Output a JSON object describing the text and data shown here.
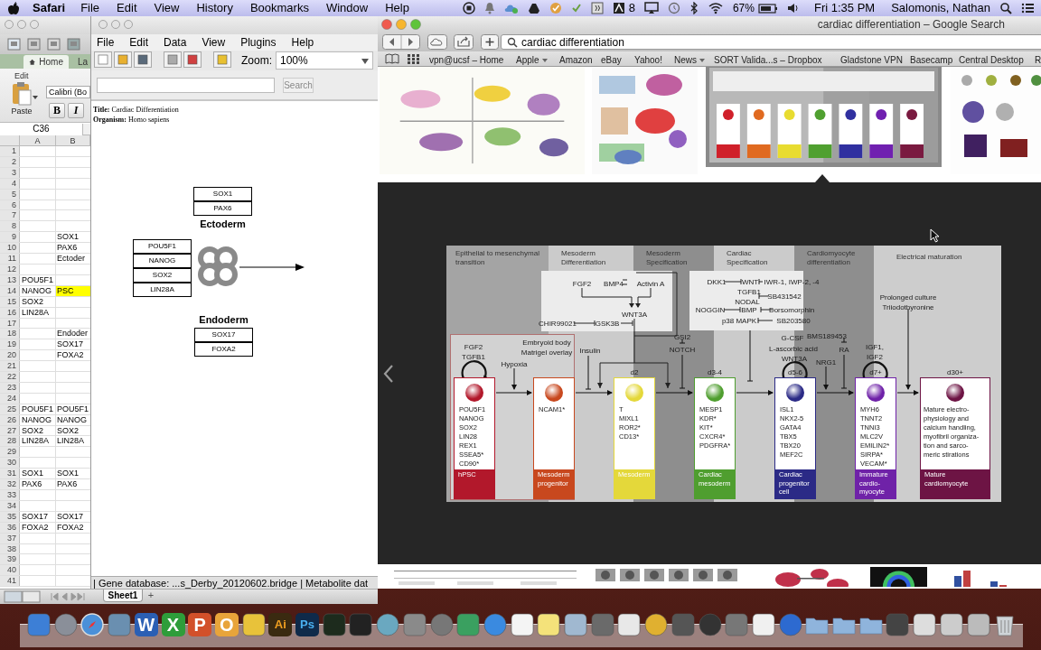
{
  "menu_bar": {
    "app": "Safari",
    "menus": [
      "File",
      "Edit",
      "View",
      "History",
      "Bookmarks",
      "Window",
      "Help"
    ],
    "badge_count": "8",
    "battery": "67%",
    "clock": "Fri 1:35 PM",
    "user": "Salomonis, Nathan"
  },
  "excel": {
    "tabs": [
      {
        "label": "Home",
        "selected": true
      },
      {
        "label": "La",
        "selected": false
      }
    ],
    "group_label": "Edit",
    "paste_label": "Paste",
    "font": "Calibri (Bo",
    "bold_button": "B",
    "italic_button": "I",
    "name_box": "C36",
    "columns": [
      "A",
      "B"
    ],
    "rows": [
      {
        "number": "1",
        "highlighted": false
      },
      {
        "number": "2",
        "highlighted": false
      },
      {
        "number": "3",
        "highlighted": false
      },
      {
        "number": "4",
        "highlighted": false
      },
      {
        "number": "5",
        "highlighted": false
      },
      {
        "number": "6",
        "highlighted": false
      },
      {
        "number": "7",
        "highlighted": false
      },
      {
        "number": "8",
        "highlighted": false
      },
      {
        "number": "9",
        "b": "SOX1",
        "highlighted": false
      },
      {
        "number": "10",
        "b": "PAX6",
        "highlighted": false
      },
      {
        "number": "11",
        "b": "Ectoder",
        "highlighted": false
      },
      {
        "number": "12",
        "highlighted": false
      },
      {
        "number": "13",
        "a": "POU5F1",
        "highlighted": false
      },
      {
        "number": "14",
        "a": "NANOG",
        "b": "PSC",
        "highlighted": true
      },
      {
        "number": "15",
        "a": "SOX2",
        "highlighted": false
      },
      {
        "number": "16",
        "a": "LIN28A",
        "highlighted": false
      },
      {
        "number": "17",
        "highlighted": false
      },
      {
        "number": "18",
        "b": "Endoder",
        "highlighted": false
      },
      {
        "number": "19",
        "b": "SOX17",
        "highlighted": false
      },
      {
        "number": "20",
        "b": "FOXA2",
        "highlighted": false
      },
      {
        "number": "21",
        "highlighted": false
      },
      {
        "number": "22",
        "highlighted": false
      },
      {
        "number": "23",
        "highlighted": false
      },
      {
        "number": "24",
        "highlighted": false
      },
      {
        "number": "25",
        "a": "POU5F1",
        "b": "POU5F1",
        "highlighted": false
      },
      {
        "number": "26",
        "a": "NANOG",
        "b": "NANOG",
        "highlighted": false
      },
      {
        "number": "27",
        "a": "SOX2",
        "b": "SOX2",
        "highlighted": false
      },
      {
        "number": "28",
        "a": "LIN28A",
        "b": "LIN28A",
        "highlighted": false
      },
      {
        "number": "29",
        "highlighted": false
      },
      {
        "number": "30",
        "highlighted": false
      },
      {
        "number": "31",
        "a": "SOX1",
        "b": "SOX1",
        "highlighted": false
      },
      {
        "number": "32",
        "a": "PAX6",
        "b": "PAX6",
        "highlighted": false
      },
      {
        "number": "33",
        "highlighted": false
      },
      {
        "number": "34",
        "highlighted": false
      },
      {
        "number": "35",
        "a": "SOX17",
        "b": "SOX17",
        "highlighted": false
      },
      {
        "number": "36",
        "a": "FOXA2",
        "b": "FOXA2",
        "highlighted": false
      },
      {
        "number": "37",
        "highlighted": false
      },
      {
        "number": "38",
        "highlighted": false
      },
      {
        "number": "39",
        "highlighted": false
      },
      {
        "number": "40",
        "highlighted": false
      },
      {
        "number": "41",
        "highlighted": false
      }
    ],
    "sheet_tab": "Sheet1",
    "add_sheet": "+"
  },
  "pathvisio": {
    "menus": [
      "File",
      "Edit",
      "Data",
      "View",
      "Plugins",
      "Help"
    ],
    "zoom_label": "Zoom:",
    "zoom": "100%",
    "search_button": "Search",
    "title_line": "**Title:**  Cardiac Differentiation",
    "organism_line": "**Organism:**  Homo sapiens",
    "groups": [
      {
        "label": "Ectoderm",
        "genes": [
          "SOX1",
          "PAX6"
        ]
      },
      {
        "genes": [
          "POU5F1",
          "NANOG",
          "SOX2",
          "LIN28A"
        ]
      },
      {
        "label": "Endoderm",
        "genes": [
          "SOX17",
          "FOXA2"
        ]
      }
    ],
    "status": "| Gene database: ...s_Derby_20120602.bridge | Metabolite dat"
  },
  "safari": {
    "title": "cardiac differentiation – Google Search",
    "address": "cardiac differentiation",
    "bookmarks": [
      {
        "label": "vpn@ucsf – Home",
        "menu": false
      },
      {
        "label": "Apple",
        "menu": true
      },
      {
        "label": "Amazon",
        "menu": false
      },
      {
        "label": "eBay",
        "menu": false
      },
      {
        "label": "Yahoo!",
        "menu": false
      },
      {
        "label": "News",
        "menu": true
      },
      {
        "label": "SORT Valida...s – Dropbox",
        "menu": false
      },
      {
        "label": "Gladstone VPN",
        "menu": false
      },
      {
        "label": "Basecamp",
        "menu": false
      },
      {
        "label": "Central Desktop",
        "menu": false
      },
      {
        "label": "R"
      }
    ],
    "results": [
      {
        "kind": "picture",
        "selected": false
      },
      {
        "kind": "picture",
        "selected": false
      },
      {
        "kind": "picture",
        "selected": true
      },
      {
        "kind": "picture",
        "selected": false
      }
    ]
  },
  "figure": {
    "bands": [
      "Epithelial to mesenchymal transition",
      "Mesoderm Differentiation",
      "Mesoderm Specification",
      "Cardiac Specification",
      "Cardiomyocyte differentiation",
      "Electrical maturation"
    ],
    "labels": [
      "FGF2",
      "BMP4",
      "Activin A",
      "WNT3A",
      "CHIR99021",
      "GSK3B",
      "DKK1",
      "WNT",
      "IWR-1, IWP-2, -4",
      "TGFB1",
      "NODAL",
      "SB431542",
      "NOGGIN",
      "BMP",
      "Dorsomorphin",
      "p38 MAPK",
      "SB203580",
      "FGF2",
      "TGFB1",
      "Hypoxia",
      "Embryoid body",
      "Matrigel overlay",
      "Insulin",
      "GSI2",
      "NOTCH",
      "G-CSF",
      "L-ascorbic acid",
      "WNT3A",
      "BMS189453",
      "RA",
      "NRG1",
      "IGF1,",
      "IGF2",
      "Prolonged culture",
      "Triiodothyronine"
    ],
    "stages": [
      {
        "markers": [
          "POU5F1",
          "NANOG",
          "SOX2",
          "LIN28",
          "REX1",
          "SSEA5*",
          "CD90*"
        ],
        "label": [
          "hPSC"
        ],
        "color": "#b2182b"
      },
      {
        "markers": [
          "NCAM1*"
        ],
        "label": [
          "Mesoderm",
          "progenitor"
        ],
        "color": "#c8481e"
      },
      {
        "day": "d2",
        "markers": [
          "T",
          "MIXL1",
          "ROR2*",
          "CD13*"
        ],
        "label": [
          "Mesoderm"
        ],
        "color": "#e4d83a"
      },
      {
        "day": "d3-4",
        "markers": [
          "MESP1",
          "KDR*",
          "KIT*",
          "CXCR4*",
          "PDGFRA*"
        ],
        "label": [
          "Cardiac",
          "mesoderm"
        ],
        "color": "#4f9e2f"
      },
      {
        "day": "d5-6",
        "markers": [
          "ISL1",
          "NKX2-5",
          "GATA4",
          "TBX5",
          "TBX20",
          "MEF2C"
        ],
        "label": [
          "Cardiac",
          "progenitor",
          "cell"
        ],
        "color": "#2b2a86"
      },
      {
        "day": "d7+",
        "markers": [
          "MYH6",
          "TNNT2",
          "TNNI3",
          "MLC2V",
          "EMILIN2*",
          "SIRPA*",
          "VECAM*"
        ],
        "label": [
          "Immature",
          "cardio-",
          "myocyte"
        ],
        "color": "#6f22a8"
      },
      {
        "day": "d30+",
        "markers": [
          "Mature electro-",
          "physiology and",
          "calcium handling,",
          "myofibril organiza-",
          "tion and sarco-",
          "meric stirations"
        ],
        "label": [
          "Mature",
          "cardiomyocyte"
        ],
        "color": "#6d1444"
      }
    ]
  },
  "dock": {
    "glyphs": [
      "W",
      "X",
      "P",
      "O",
      "Ai",
      "Ps"
    ]
  }
}
